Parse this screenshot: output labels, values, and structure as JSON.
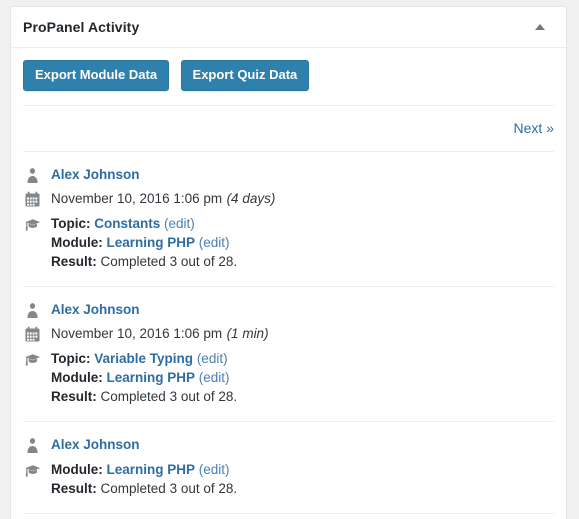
{
  "panel": {
    "title": "ProPanel Activity",
    "toggle_icon": "triangle-up-icon",
    "toggle_state": "expanded"
  },
  "toolbar": {
    "buttons": [
      {
        "label": "Export Module Data",
        "name": "export-module-data-button"
      },
      {
        "label": "Export Quiz Data",
        "name": "export-quiz-data-button"
      }
    ],
    "button_color": "#2e81ac",
    "button_text_color": "#ffffff"
  },
  "pagination": {
    "next_label": "Next »"
  },
  "link_color": "#2e6da4",
  "activities": [
    {
      "user": "Alex Johnson",
      "user_icon": "user-icon",
      "date_icon": "calendar-icon",
      "date": "November 10, 2016 1:06 pm",
      "date_relative": "(4 days)",
      "detail_icon": "graduation-cap-icon",
      "topic_label": "Topic:",
      "topic_value": "Constants",
      "topic_edit": "(edit)",
      "module_label": "Module:",
      "module_value": "Learning PHP",
      "module_edit": "(edit)",
      "result_label": "Result:",
      "result_value": "Completed 3 out of 28."
    },
    {
      "user": "Alex Johnson",
      "user_icon": "user-icon",
      "date_icon": "calendar-icon",
      "date": "November 10, 2016 1:06 pm",
      "date_relative": "(1 min)",
      "detail_icon": "graduation-cap-icon",
      "topic_label": "Topic:",
      "topic_value": "Variable Typing",
      "topic_edit": "(edit)",
      "module_label": "Module:",
      "module_value": "Learning PHP",
      "module_edit": "(edit)",
      "result_label": "Result:",
      "result_value": "Completed 3 out of 28."
    },
    {
      "user": "Alex Johnson",
      "user_icon": "user-icon",
      "detail_icon": "graduation-cap-icon",
      "module_label": "Module:",
      "module_value": "Learning PHP",
      "module_edit": "(edit)",
      "result_label": "Result:",
      "result_value": "Completed 3 out of 28."
    }
  ]
}
